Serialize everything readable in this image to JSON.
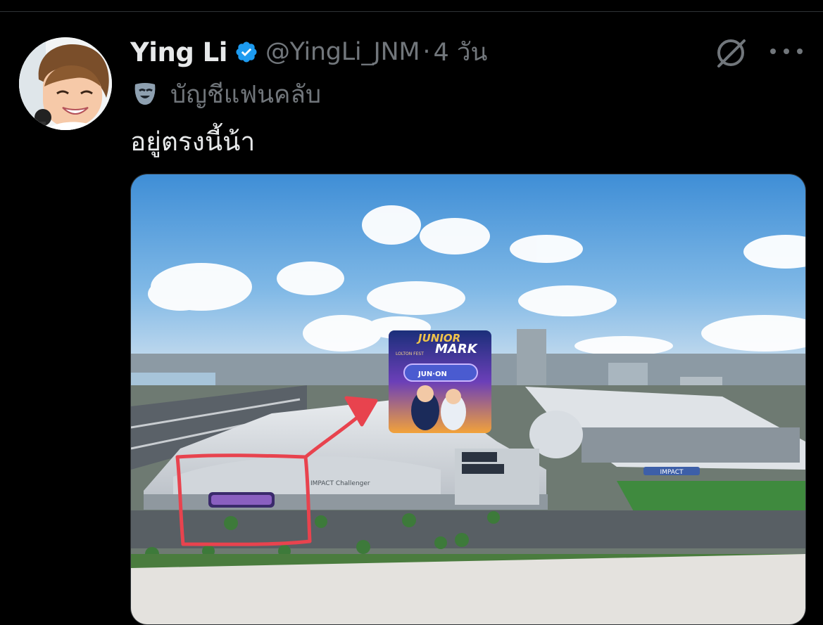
{
  "tweet": {
    "author": {
      "display_name": "Ying Li",
      "handle": "@YingLi_JNM",
      "verified": true
    },
    "separator": "·",
    "time_ago": "4 วัน",
    "affiliation": {
      "icon": "theater-mask-icon",
      "label": "บัญชีแฟนคลับ"
    },
    "text": "อยู่ตรงนี้น้า",
    "actions": {
      "grok_icon": "grok-icon",
      "more_icon": "more-options-icon"
    },
    "media": {
      "banner": {
        "line1": "JUNIOR",
        "line2": "MARK",
        "strip": "JUN·ON",
        "sub": "LOLTON FEST"
      },
      "building_sign": "IMPACT Challenger",
      "hall_sign": "IMPACT",
      "annotation_color": "#e8434e"
    }
  },
  "colors": {
    "background": "#000000",
    "text_primary": "#e7e9ea",
    "text_secondary": "#71767b",
    "verified_blue": "#1d9bf0"
  }
}
